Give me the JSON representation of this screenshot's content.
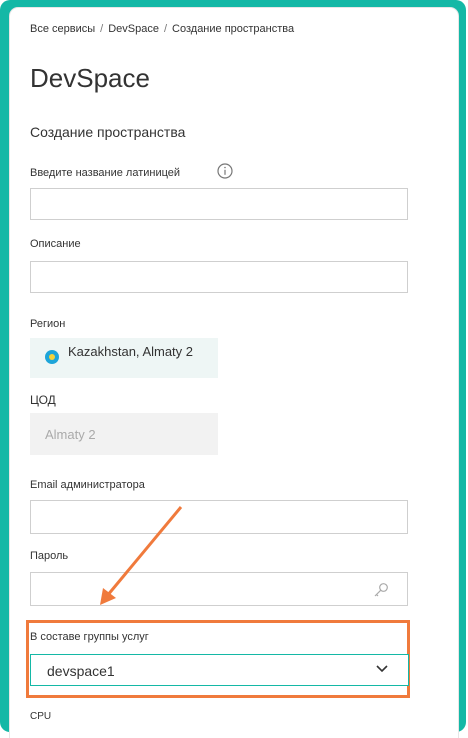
{
  "breadcrumb": {
    "items": [
      "Все сервисы",
      "DevSpace",
      "Создание пространства"
    ],
    "separator": "/"
  },
  "page": {
    "title": "DevSpace",
    "subtitle": "Создание пространства"
  },
  "form": {
    "name_label": "Введите название латиницей",
    "description_label": "Описание",
    "region_label": "Регион",
    "region_value": "Kazakhstan, Almaty 2",
    "dc_label": "ЦОД",
    "dc_value": "Almaty 2",
    "email_label": "Email администратора",
    "password_label": "Пароль",
    "service_group_label": "В составе группы услуг",
    "service_group_value": "devspace1",
    "cpu_label": "CPU"
  },
  "colors": {
    "frame": "#14b8a6",
    "highlight": "#f07a3c",
    "flag": "#1ea5d9"
  },
  "icons": {
    "info": "info-circle-icon",
    "flag": "kazakhstan-flag-icon",
    "password": "key-icon",
    "dropdown": "chevron-down-icon"
  }
}
